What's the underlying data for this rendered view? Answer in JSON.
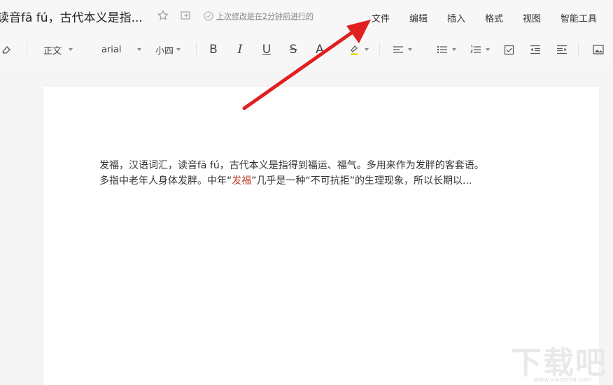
{
  "header": {
    "doc_title": "读音fā fú，古代本义是指...",
    "save_status": "上次修改是在2分钟前进行的",
    "menus": [
      "文件",
      "编辑",
      "插入",
      "格式",
      "视图",
      "智能工具"
    ]
  },
  "toolbar": {
    "style_value": "正文",
    "font_value": "arial",
    "size_value": "小四",
    "bold_label": "B",
    "italic_label": "I",
    "underline_label": "U",
    "strike_label": "S",
    "font_color_label": "A",
    "icons": [
      "eraser-icon",
      "highlighter-icon",
      "align-icon",
      "bullet-list-icon",
      "numbered-list-icon",
      "checkbox-icon",
      "outdent-icon",
      "indent-icon",
      "image-icon"
    ]
  },
  "document": {
    "line1": "发福，汉语词汇，读音fā fú，古代本义是指得到福运、福气。多用来作为发胖的客套语。",
    "line2_a": "多指中老年人身体发胖。中年“",
    "line2_red": "发福",
    "line2_b": "”几乎是一种“不可抗拒”的生理现象，所以长期以..."
  },
  "watermark": {
    "logo_text": "下载吧",
    "url": "www.xiazaiba.com"
  },
  "colors": {
    "annotation_arrow": "#e02020",
    "highlight_red": "#c0392b",
    "highlighter_yellow": "#f4d000"
  }
}
